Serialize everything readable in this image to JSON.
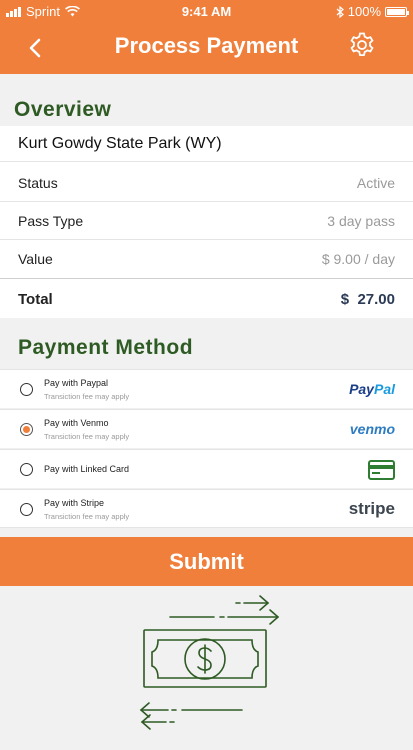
{
  "status_bar": {
    "carrier": "Sprint",
    "time": "9:41 AM",
    "battery": "100%",
    "battery_level": 1.0
  },
  "header": {
    "title": "Process Payment",
    "back_icon": "chevron-left-icon",
    "settings_icon": "gear-icon"
  },
  "overview": {
    "title": "Overview",
    "park": "Kurt Gowdy State Park (WY)",
    "rows": [
      {
        "label": "Status",
        "value": "Active"
      },
      {
        "label": "Pass Type",
        "value": "3 day pass"
      },
      {
        "label": "Value",
        "value": "$ 9.00 / day"
      }
    ],
    "total": {
      "label": "Total",
      "value": "$  27.00"
    }
  },
  "payment": {
    "title": "Payment Method",
    "methods": [
      {
        "name": "Pay with Paypal",
        "note": "Transiction fee may apply",
        "brand": "PayPal",
        "selected": false
      },
      {
        "name": "Pay with Venmo",
        "note": "Transiction fee may apply",
        "brand": "venmo",
        "selected": true
      },
      {
        "name": "Pay with Linked Card",
        "note": "",
        "brand": "card-icon",
        "selected": false
      },
      {
        "name": "Pay with Stripe",
        "note": "Transiction fee may apply",
        "brand": "stripe",
        "selected": false
      }
    ]
  },
  "submit_label": "Submit",
  "colors": {
    "accent": "#f07f3b",
    "heading": "#2e5a24",
    "illustration": "#2e5a24",
    "total": "#2b3a55"
  }
}
